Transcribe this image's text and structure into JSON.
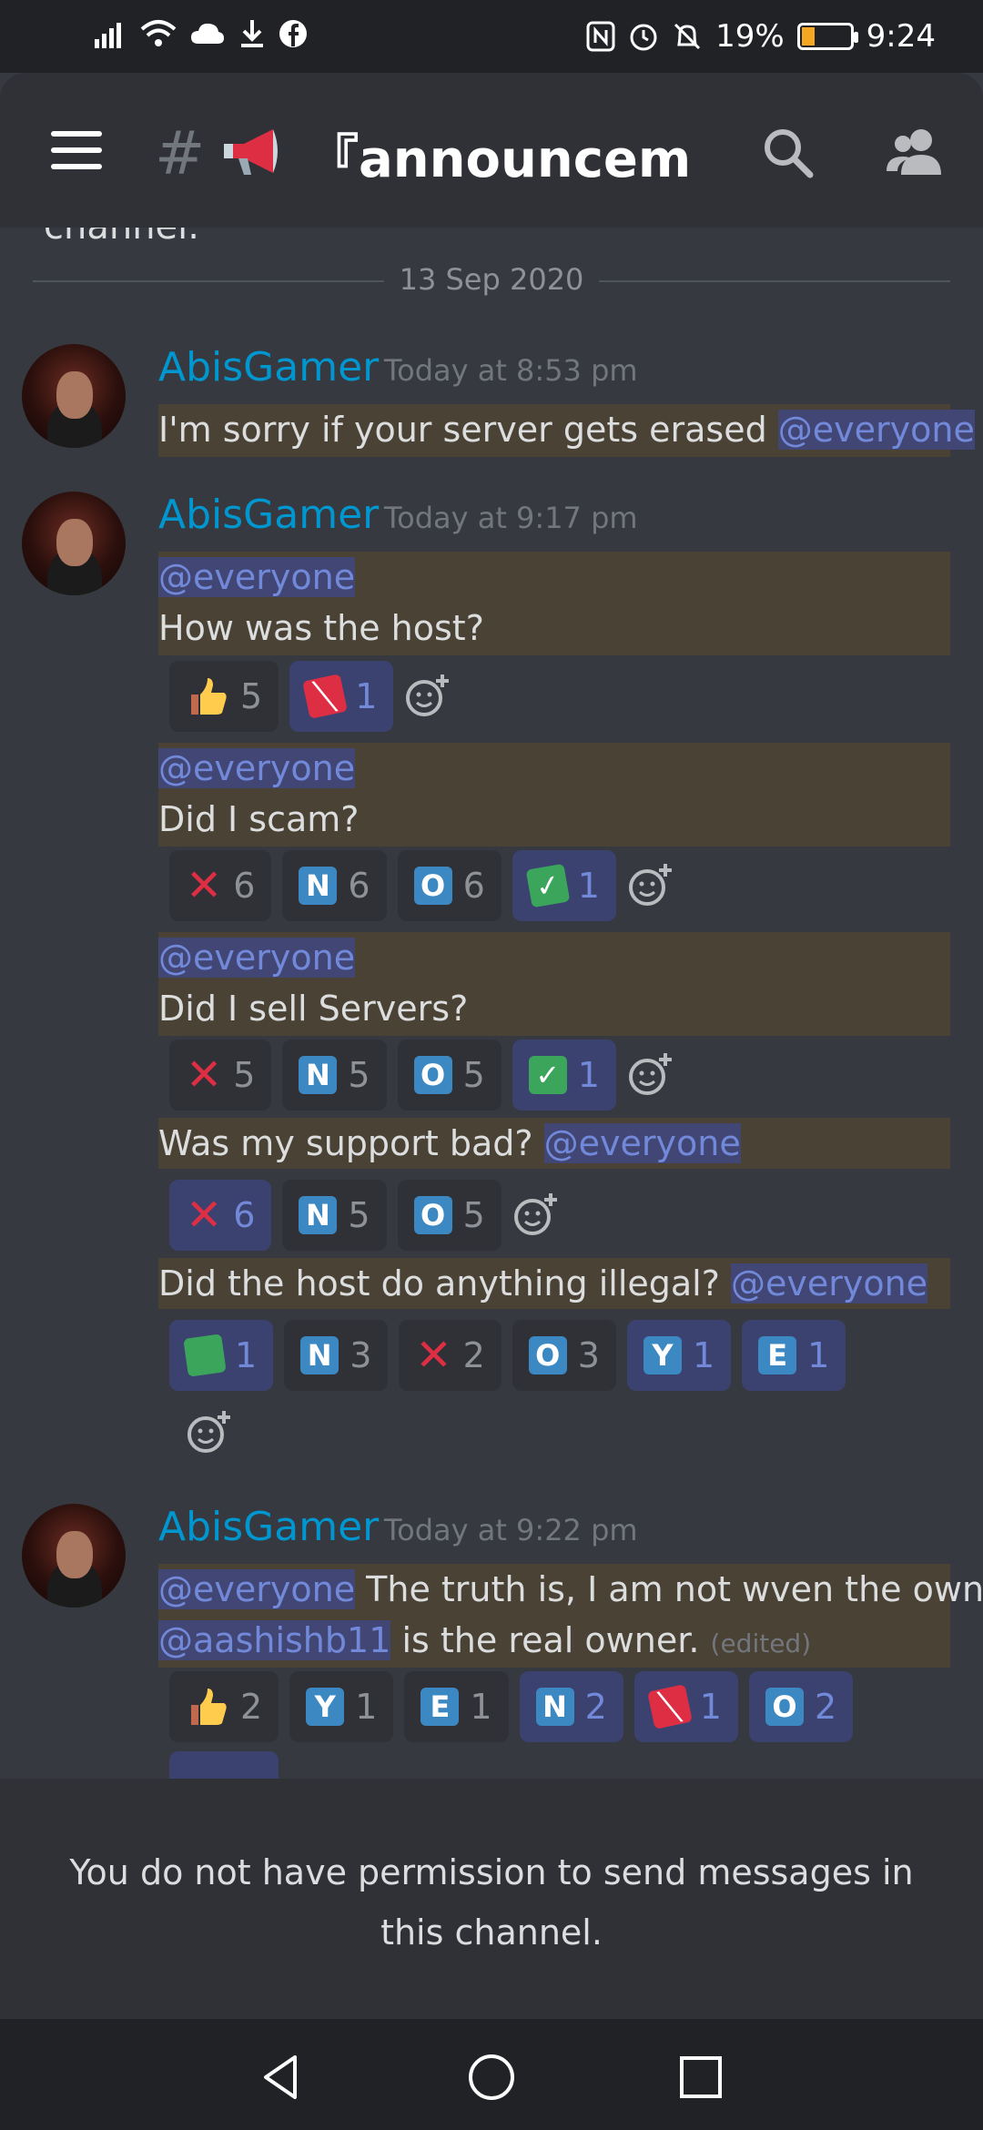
{
  "status_bar": {
    "battery_pct": "19%",
    "time": "9:24",
    "battery_color": "#f5a623"
  },
  "header": {
    "channel_name": "『announceme...",
    "icons": [
      "menu-icon",
      "hash-icon",
      "megaphone-icon",
      "search-icon",
      "members-icon"
    ]
  },
  "messages": {
    "clipped_text": "channel.",
    "date_divider": "13 Sep 2020",
    "groups": [
      {
        "username": "AbisGamer",
        "timestamp": "Today at 8:53 pm",
        "lines": [
          {
            "text": "I'm sorry if your server gets erased ",
            "mention": "@everyone"
          }
        ]
      },
      {
        "username": "AbisGamer",
        "timestamp": "Today at 9:17 pm",
        "blocks": [
          {
            "mention_line": "@everyone",
            "text": "How was the host?",
            "reactions": [
              {
                "emoji": "thumbs-up-icon",
                "count": "5"
              },
              {
                "emoji": "red-tile-icon",
                "count": "1"
              }
            ]
          },
          {
            "mention_line": "@everyone",
            "text": "Did I scam?",
            "reactions": [
              {
                "emoji": "cross-mark-icon",
                "count": "6"
              },
              {
                "emoji": "N",
                "count": "6"
              },
              {
                "emoji": "O",
                "count": "6"
              },
              {
                "emoji": "green-check-icon",
                "count": "1"
              }
            ]
          },
          {
            "mention_line": "@everyone",
            "text": "Did I sell Servers?",
            "reactions": [
              {
                "emoji": "cross-mark-icon",
                "count": "5"
              },
              {
                "emoji": "N",
                "count": "5"
              },
              {
                "emoji": "O",
                "count": "5"
              },
              {
                "emoji": "green-check-icon",
                "count": "1"
              }
            ]
          },
          {
            "text": "Was my support bad? ",
            "mention": "@everyone",
            "reactions": [
              {
                "emoji": "cross-mark-icon",
                "count": "6"
              },
              {
                "emoji": "N",
                "count": "5"
              },
              {
                "emoji": "O",
                "count": "5"
              }
            ]
          },
          {
            "text": "Did the host do anything illegal? ",
            "mention": "@everyone",
            "reactions": [
              {
                "emoji": "green-tile-icon",
                "count": "1"
              },
              {
                "emoji": "N",
                "count": "3"
              },
              {
                "emoji": "cross-mark-icon",
                "count": "2"
              },
              {
                "emoji": "O",
                "count": "3"
              },
              {
                "emoji": "Y",
                "count": "1"
              },
              {
                "emoji": "E",
                "count": "1"
              }
            ]
          }
        ]
      },
      {
        "username": "AbisGamer",
        "timestamp": "Today at 9:22 pm",
        "line1_mention": "@everyone",
        "line1_text": " The truth is, I am not wven the owner.",
        "line2_mention": "@aashishb11",
        "line2_text": " is the real owner. ",
        "edited": "(edited)",
        "reactions": [
          {
            "emoji": "thumbs-up-icon",
            "count": "2"
          },
          {
            "emoji": "Y",
            "count": "1"
          },
          {
            "emoji": "E",
            "count": "1"
          },
          {
            "emoji": "N",
            "count": "2"
          },
          {
            "emoji": "red-tile-icon",
            "count": "1"
          },
          {
            "emoji": "O",
            "count": "2"
          }
        ]
      }
    ]
  },
  "footer": {
    "permission_text": "You do not have permission to send messages in this channel."
  },
  "nav": {
    "buttons": [
      "back-icon",
      "home-icon",
      "recents-icon"
    ]
  }
}
